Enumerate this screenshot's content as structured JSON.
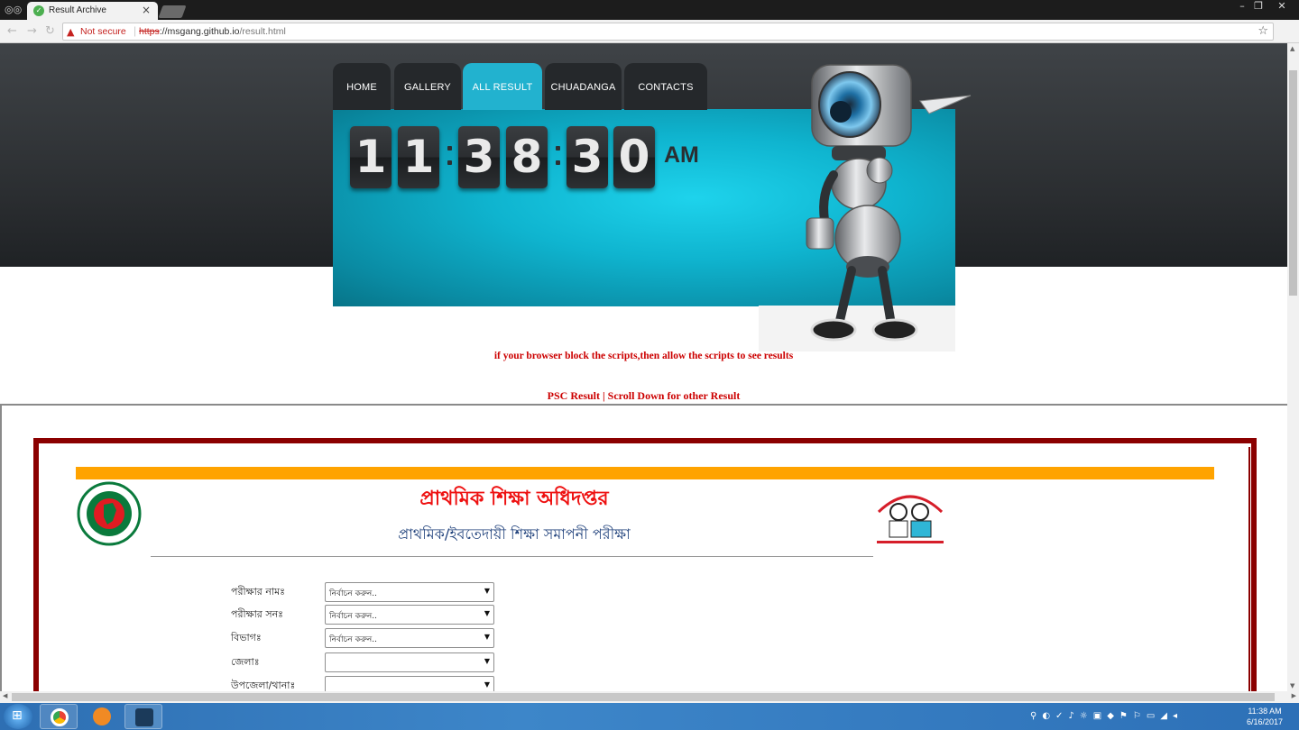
{
  "browser": {
    "tab_title": "Result Archive",
    "tab_close": "×",
    "not_secure": "Not secure",
    "url_proto": "https",
    "url_domain": "://msgang.github.io",
    "url_path": "/result.html"
  },
  "nav": {
    "items": [
      {
        "label": "HOME"
      },
      {
        "label": "GALLERY"
      },
      {
        "label": "ALL RESULT",
        "active": true
      },
      {
        "label": "CHUADANGA"
      },
      {
        "label": "CONTACTS"
      }
    ]
  },
  "clock": {
    "digits": [
      "1",
      "1",
      "3",
      "8",
      "3",
      "0"
    ],
    "ampm": "AM"
  },
  "notice": "if your browser block the scripts,then allow the scripts to see results",
  "links": {
    "psc_result": "PSC Result",
    "separator": " | ",
    "other_results": "Scroll Down for other Result"
  },
  "result": {
    "title": "প্রাথমিক শিক্ষা অধিদপ্তর",
    "subtitle": "প্রাথমিক/ইবতেদায়ী শিক্ষা সমাপনী পরীক্ষা",
    "form": [
      {
        "label": "পরীক্ষার নামঃ",
        "value": "নির্বাচন করুন.."
      },
      {
        "label": "পরীক্ষার সনঃ",
        "value": "নির্বাচন করুন.."
      },
      {
        "label": "বিভাগঃ",
        "value": "নির্বাচন করুন.."
      },
      {
        "label": "জেলাঃ",
        "value": ""
      },
      {
        "label": "উপজেলা/থানাঃ",
        "value": ""
      }
    ]
  },
  "taskbar": {
    "time": "11:38 AM",
    "date": "6/16/2017"
  },
  "colors": {
    "accent_tab": "#22b2cf",
    "banner": "#0fb4cf",
    "notice_red": "#cc0000",
    "frame_maroon": "#8b0000",
    "orange_bar": "#ffa300",
    "title_red": "#ee1111",
    "subtitle_blue": "#1d3f7a"
  },
  "icons": {
    "back": "back-arrow-icon",
    "reload": "reload-icon",
    "warning": "warning-icon",
    "bookmark": "star-icon"
  }
}
